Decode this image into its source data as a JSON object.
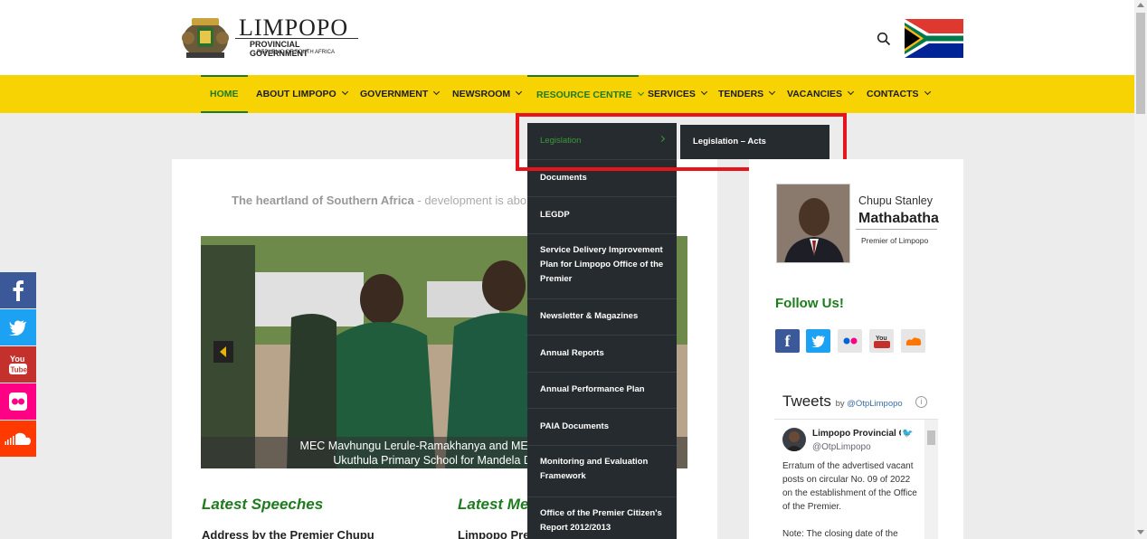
{
  "header": {
    "logo_title": "LIMPOPO",
    "logo_subtitle": "PROVINCIAL GOVERNMENT",
    "logo_country": "REPUBLIC OF SOUTH AFRICA"
  },
  "nav": {
    "items": [
      {
        "label": "HOME"
      },
      {
        "label": "ABOUT LIMPOPO"
      },
      {
        "label": "GOVERNMENT"
      },
      {
        "label": "NEWSROOM"
      },
      {
        "label": "RESOURCE CENTRE"
      },
      {
        "label": "SERVICES"
      },
      {
        "label": "TENDERS"
      },
      {
        "label": "VACANCIES"
      },
      {
        "label": "CONTACTS"
      }
    ]
  },
  "dropdown": {
    "items": [
      {
        "label": "Legislation"
      },
      {
        "label": "Documents"
      },
      {
        "label": "LEGDP"
      },
      {
        "label": "Service Delivery Improvement Plan for Limpopo Office of the Premier"
      },
      {
        "label": "Newsletter & Magazines"
      },
      {
        "label": "Annual Reports"
      },
      {
        "label": "Annual Performance Plan"
      },
      {
        "label": "PAIA Documents"
      },
      {
        "label": "Monitoring and Evaluation Framework"
      },
      {
        "label": "Office of the Premier Citizen's Report 2012/2013"
      }
    ],
    "submenu": {
      "label": "Legislation – Acts"
    }
  },
  "main": {
    "tagline_bold": "The heartland of Southern Africa",
    "tagline_rest": " - development is abo",
    "slider_caption_line1": "MEC Mavhungu Lerule-Ramakhanya and MEC Dr Dickso",
    "slider_caption_line2": "Ukuthula Primary School for Mandela Day C",
    "latest_speeches": "Latest Speeches",
    "latest_media": "Latest Med",
    "speech_title": "Address by the Premier Chupu",
    "media_title": "Limpopo Pre"
  },
  "sidebar": {
    "premier_first": "Chupu Stanley",
    "premier_last": "Mathabatha",
    "premier_role": "Premier of Limpopo",
    "follow_title": "Follow Us!",
    "follow_icons": [
      "facebook-icon",
      "twitter-icon",
      "flickr-icon",
      "youtube-icon",
      "soundcloud-icon"
    ],
    "tweets_title": "Tweets",
    "tweets_by": "by",
    "tweets_handle": "@OtpLimpopo",
    "tweet": {
      "name": "Limpopo Provincial G",
      "handle": "@OtpLimpopo",
      "text": "Erratum of the advertised vacant posts on circular No. 09 of 2022 on the establishment of the Office of the Premier.",
      "text2": "Note: The closing date of the"
    }
  },
  "social_bar": [
    "facebook-icon",
    "twitter-icon",
    "youtube-icon",
    "flickr-icon",
    "soundcloud-icon"
  ],
  "colors": {
    "nav_bg": "#f7d303",
    "brand_green": "#1e7b1e",
    "dropdown_bg": "#252b2f",
    "highlight_red": "#e8141c"
  }
}
